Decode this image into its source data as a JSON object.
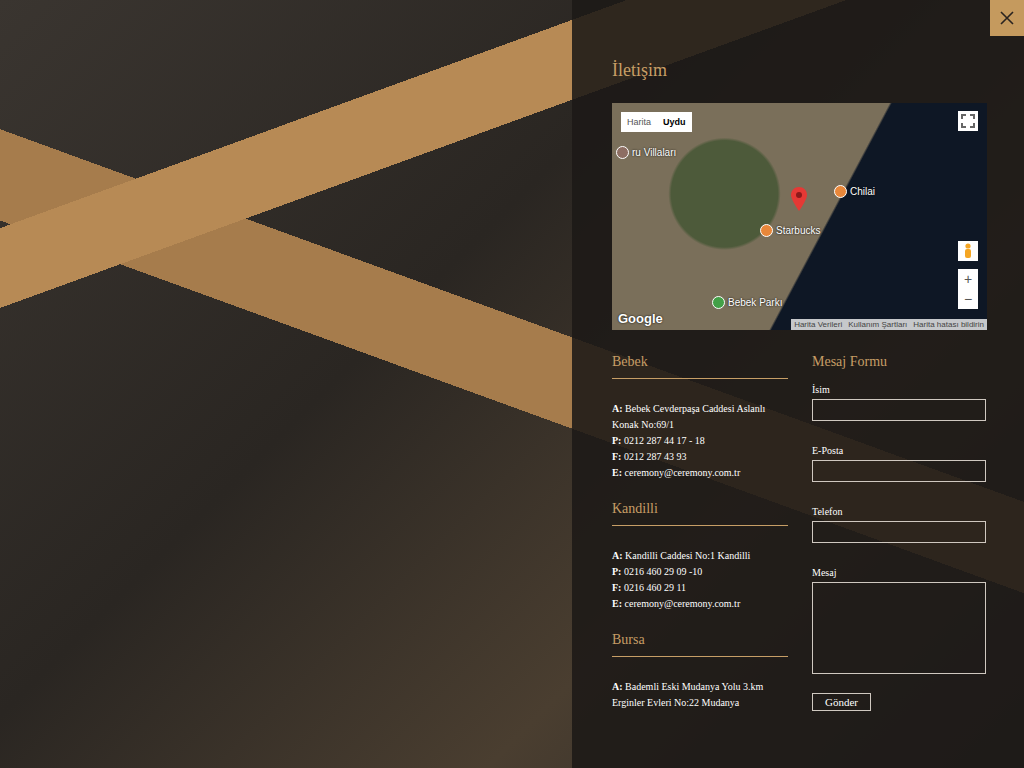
{
  "title": "İletişim",
  "map": {
    "type_tabs": [
      {
        "label": "Harita",
        "selected": false
      },
      {
        "label": "Uydu",
        "selected": true
      }
    ],
    "places": [
      {
        "label": "ru Villaları"
      },
      {
        "label": "Chilai"
      },
      {
        "label": "Starbucks"
      },
      {
        "label": "Bebek Parkı"
      }
    ],
    "zoom_in": "+",
    "zoom_out": "−",
    "logo": "Google",
    "footer": [
      "Harita Verileri",
      "Kullanım Şartları",
      "Harita hatası bildirin"
    ]
  },
  "offices": [
    {
      "name": "Bebek",
      "lines": [
        {
          "label": "A:",
          "value": "Bebek Cevderpaşa Caddesi Aslanlı Konak No:69/1"
        },
        {
          "label": "P:",
          "value": "0212 287 44 17 - 18"
        },
        {
          "label": "F:",
          "value": "0212 287 43 93"
        },
        {
          "label": "E:",
          "value": "ceremony@ceremony.com.tr"
        }
      ]
    },
    {
      "name": "Kandilli",
      "lines": [
        {
          "label": "A:",
          "value": "Kandilli Caddesi No:1 Kandilli"
        },
        {
          "label": "P:",
          "value": "0216 460 29 09 -10"
        },
        {
          "label": "F:",
          "value": "0216 460 29 11"
        },
        {
          "label": "E:",
          "value": "ceremony@ceremony.com.tr"
        }
      ]
    },
    {
      "name": "Bursa",
      "lines": [
        {
          "label": "A:",
          "value": "Bademli Eski Mudanya Yolu 3.km Erginler Evleri No:22 Mudanya"
        }
      ]
    }
  ],
  "form": {
    "title": "Mesaj Formu",
    "fields": [
      {
        "label": "İsim",
        "kind": "input"
      },
      {
        "label": "E-Posta",
        "kind": "input"
      },
      {
        "label": "Telefon",
        "kind": "input"
      },
      {
        "label": "Mesaj",
        "kind": "textarea"
      }
    ],
    "submit": "Gönder"
  }
}
